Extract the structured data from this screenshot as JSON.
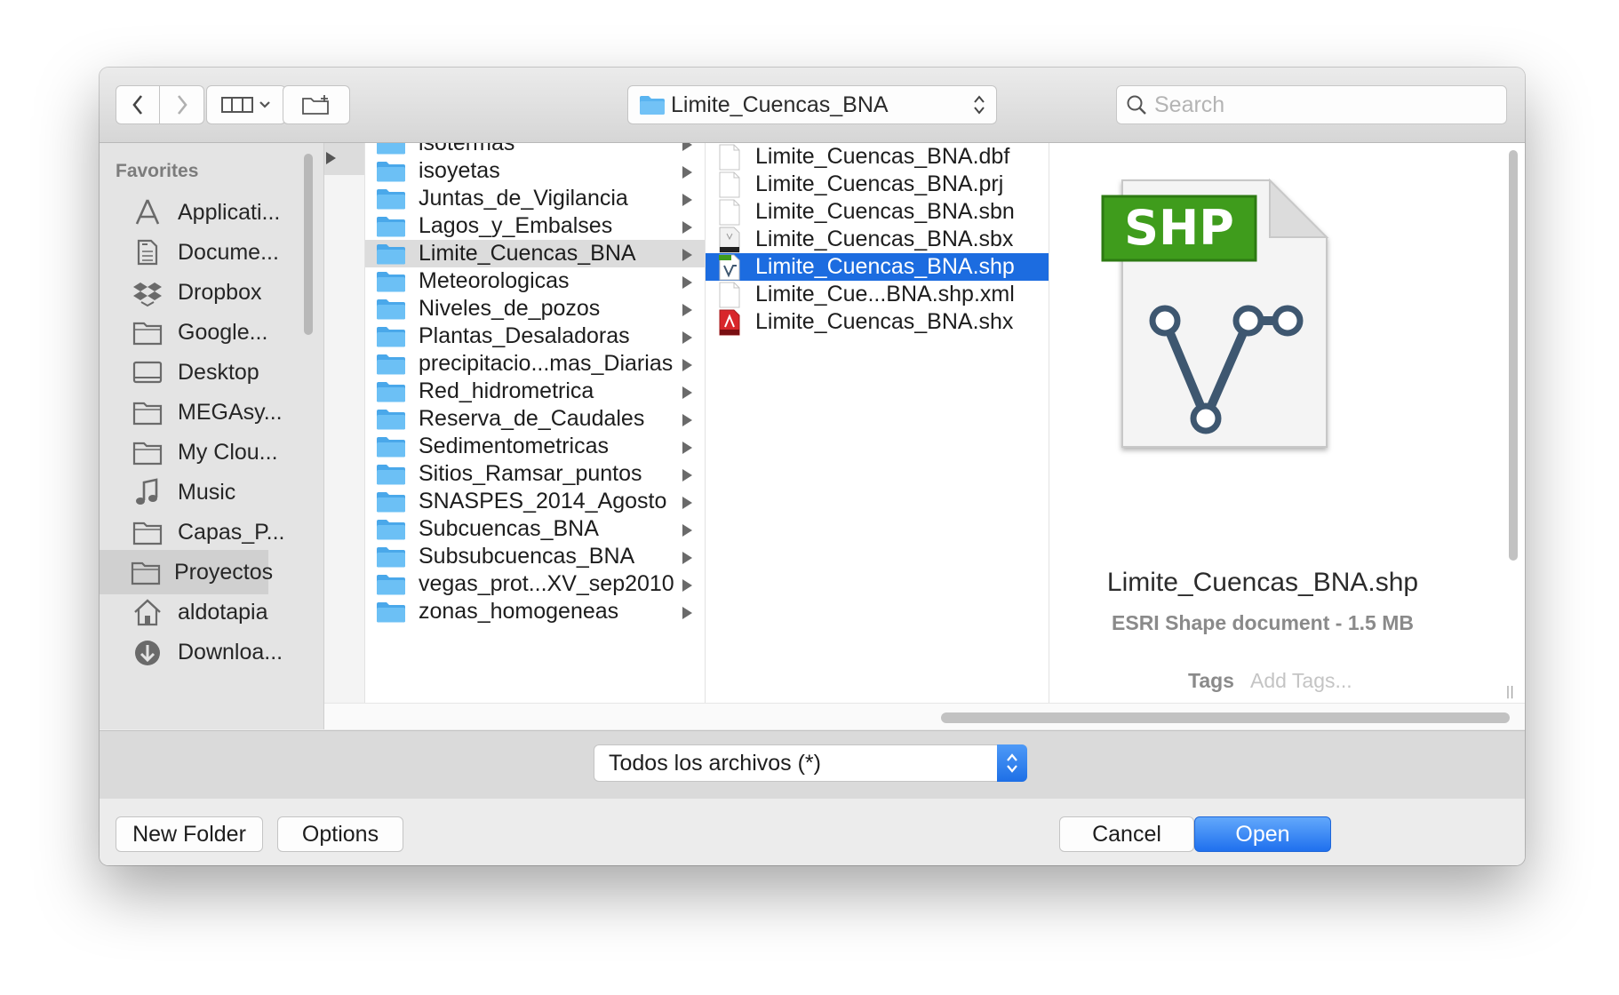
{
  "toolbar": {
    "path_label": "Limite_Cuencas_BNA",
    "search_placeholder": "Search"
  },
  "sidebar": {
    "heading": "Favorites",
    "items": [
      {
        "label": "Applicati...",
        "icon": "applications-icon"
      },
      {
        "label": "Docume...",
        "icon": "documents-icon"
      },
      {
        "label": "Dropbox",
        "icon": "dropbox-icon"
      },
      {
        "label": "Google...",
        "icon": "folder-icon"
      },
      {
        "label": "Desktop",
        "icon": "desktop-icon"
      },
      {
        "label": "MEGAsy...",
        "icon": "folder-icon"
      },
      {
        "label": "My Clou...",
        "icon": "folder-icon"
      },
      {
        "label": "Music",
        "icon": "music-icon"
      },
      {
        "label": "Capas_P...",
        "icon": "folder-icon"
      },
      {
        "label": "Proyectos",
        "icon": "folder-icon",
        "selected": true
      },
      {
        "label": "aldotapia",
        "icon": "home-icon"
      },
      {
        "label": "Downloa...",
        "icon": "downloads-icon"
      }
    ]
  },
  "folders": [
    "isotermas",
    "isoyetas",
    "Juntas_de_Vigilancia",
    "Lagos_y_Embalses",
    "Limite_Cuencas_BNA",
    "Meteorologicas",
    "Niveles_de_pozos",
    "Plantas_Desaladoras",
    "precipitacio...mas_Diarias",
    "Red_hidrometrica",
    "Reserva_de_Caudales",
    "Sedimentometricas",
    "Sitios_Ramsar_puntos",
    "SNASPES_2014_Agosto",
    "Subcuencas_BNA",
    "Subsubcuencas_BNA",
    "vegas_prot...XV_sep2010",
    "zonas_homogeneas"
  ],
  "folders_highlighted": "Limite_Cuencas_BNA",
  "files": [
    {
      "name": "Limite_Cuencas_BNA.dbf",
      "icon": "blank-file-icon"
    },
    {
      "name": "Limite_Cuencas_BNA.prj",
      "icon": "blank-file-icon"
    },
    {
      "name": "Limite_Cuencas_BNA.sbn",
      "icon": "blank-file-icon"
    },
    {
      "name": "Limite_Cuencas_BNA.sbx",
      "icon": "sbx-file-icon"
    },
    {
      "name": "Limite_Cuencas_BNA.shp",
      "icon": "shp-file-icon",
      "selected": true
    },
    {
      "name": "Limite_Cue...BNA.shp.xml",
      "icon": "blank-file-icon"
    },
    {
      "name": "Limite_Cuencas_BNA.shx",
      "icon": "shx-file-icon"
    }
  ],
  "preview": {
    "badge": "SHP",
    "name": "Limite_Cuencas_BNA.shp",
    "kind": "ESRI Shape document - 1.5 MB",
    "tags_label": "Tags",
    "tags_placeholder": "Add Tags..."
  },
  "filter": {
    "value": "Todos los archivos (*)"
  },
  "buttons": {
    "new_folder": "New Folder",
    "options": "Options",
    "cancel": "Cancel",
    "open": "Open"
  },
  "colors": {
    "selection": "#1c6ce0",
    "folder": "#5ab4f0",
    "shp_badge": "#3f9c1c",
    "shp_vector": "#3e5770"
  }
}
